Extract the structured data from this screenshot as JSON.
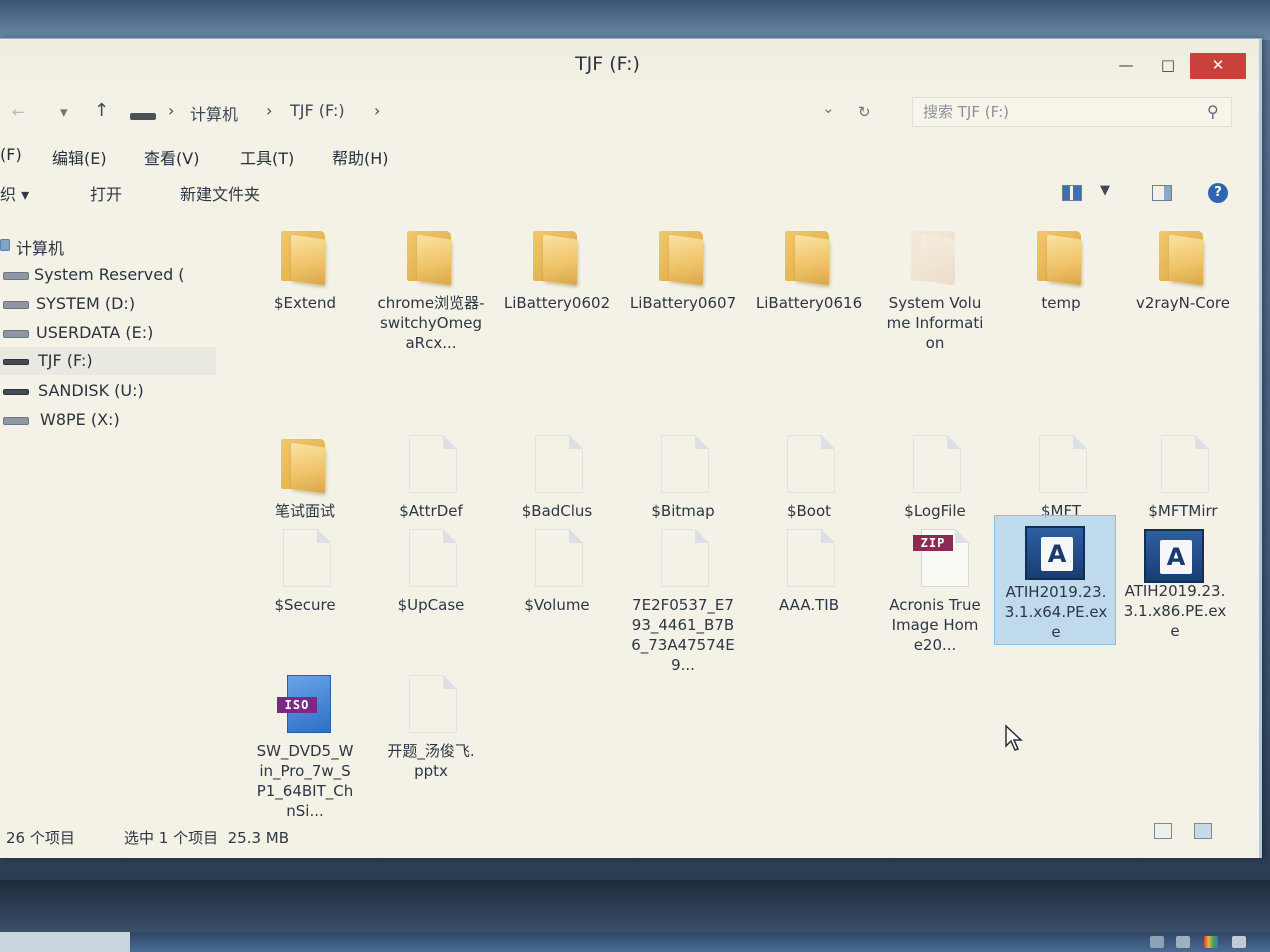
{
  "window": {
    "title": "TJF (F:)",
    "controls": {
      "minimize": "—",
      "maximize": "□",
      "close": "✕"
    }
  },
  "nav": {
    "back": "←",
    "forward": "→",
    "recent": "▾",
    "up": "↑",
    "breadcrumbs": [
      "计算机",
      "TJF (F:)"
    ],
    "separator": "›",
    "dropdown": "⌄",
    "refresh": "↻",
    "search_placeholder": "搜索 TJF (F:)",
    "search_icon": "⚲"
  },
  "menu": {
    "items": [
      "(F)",
      "编辑(E)",
      "查看(V)",
      "工具(T)",
      "帮助(H)"
    ]
  },
  "commands": {
    "organize": "织 ▾",
    "open": "打开",
    "new_folder": "新建文件夹"
  },
  "sidebar": {
    "items": [
      {
        "label": "计算机",
        "icon": "computer-icon"
      },
      {
        "label": "System Reserved (",
        "icon": "drive-icon"
      },
      {
        "label": "SYSTEM (D:)",
        "icon": "drive-icon"
      },
      {
        "label": "USERDATA (E:)",
        "icon": "drive-icon"
      },
      {
        "label": "TJF (F:)",
        "icon": "usb-drive-icon"
      },
      {
        "label": "SANDISK (U:)",
        "icon": "usb-drive-icon"
      },
      {
        "label": "W8PE (X:)",
        "icon": "drive-icon"
      }
    ]
  },
  "files": [
    {
      "name": "$Extend",
      "type": "folder"
    },
    {
      "name": "chrome浏览器-switchyOmegaRcx...",
      "type": "folder"
    },
    {
      "name": "LiBattery0602",
      "type": "folder"
    },
    {
      "name": "LiBattery0607",
      "type": "folder"
    },
    {
      "name": "LiBattery0616",
      "type": "folder"
    },
    {
      "name": "System Volume Information",
      "type": "system-folder"
    },
    {
      "name": "temp",
      "type": "folder"
    },
    {
      "name": "v2rayN-Core",
      "type": "folder"
    },
    {
      "name": "笔试面试",
      "type": "folder"
    },
    {
      "name": "$AttrDef",
      "type": "file"
    },
    {
      "name": "$BadClus",
      "type": "file"
    },
    {
      "name": "$Bitmap",
      "type": "file"
    },
    {
      "name": "$Boot",
      "type": "file"
    },
    {
      "name": "$LogFile",
      "type": "file"
    },
    {
      "name": "$MFT",
      "type": "file"
    },
    {
      "name": "$MFTMirr",
      "type": "file"
    },
    {
      "name": "$Secure",
      "type": "file"
    },
    {
      "name": "$UpCase",
      "type": "file"
    },
    {
      "name": "$Volume",
      "type": "file"
    },
    {
      "name": "7E2F0537_E793_4461_B7B6_73A47574E9...",
      "type": "file"
    },
    {
      "name": "AAA.TIB",
      "type": "file"
    },
    {
      "name": "Acronis True Image Home20...",
      "type": "zip",
      "badge": "ZIP"
    },
    {
      "name": "ATIH2019.23.3.1.x64.PE.exe",
      "type": "exe",
      "badge": "A",
      "selected": true
    },
    {
      "name": "ATIH2019.23.3.1.x86.PE.exe",
      "type": "exe",
      "badge": "A"
    },
    {
      "name": "SW_DVD5_Win_Pro_7w_SP1_64BIT_ChnSi...",
      "type": "iso",
      "badge": "ISO"
    },
    {
      "name": "开题_汤俊飞.pptx",
      "type": "file"
    }
  ],
  "status": {
    "item_count": "26 个项目",
    "selection": "选中 1 个项目  25.3 MB"
  },
  "colors": {
    "window_bg": "#f4f2e6",
    "close_button": "#c9413b",
    "selection": "#add3ec",
    "folder": "#eec267",
    "exe_tile": "#1f4b87"
  }
}
